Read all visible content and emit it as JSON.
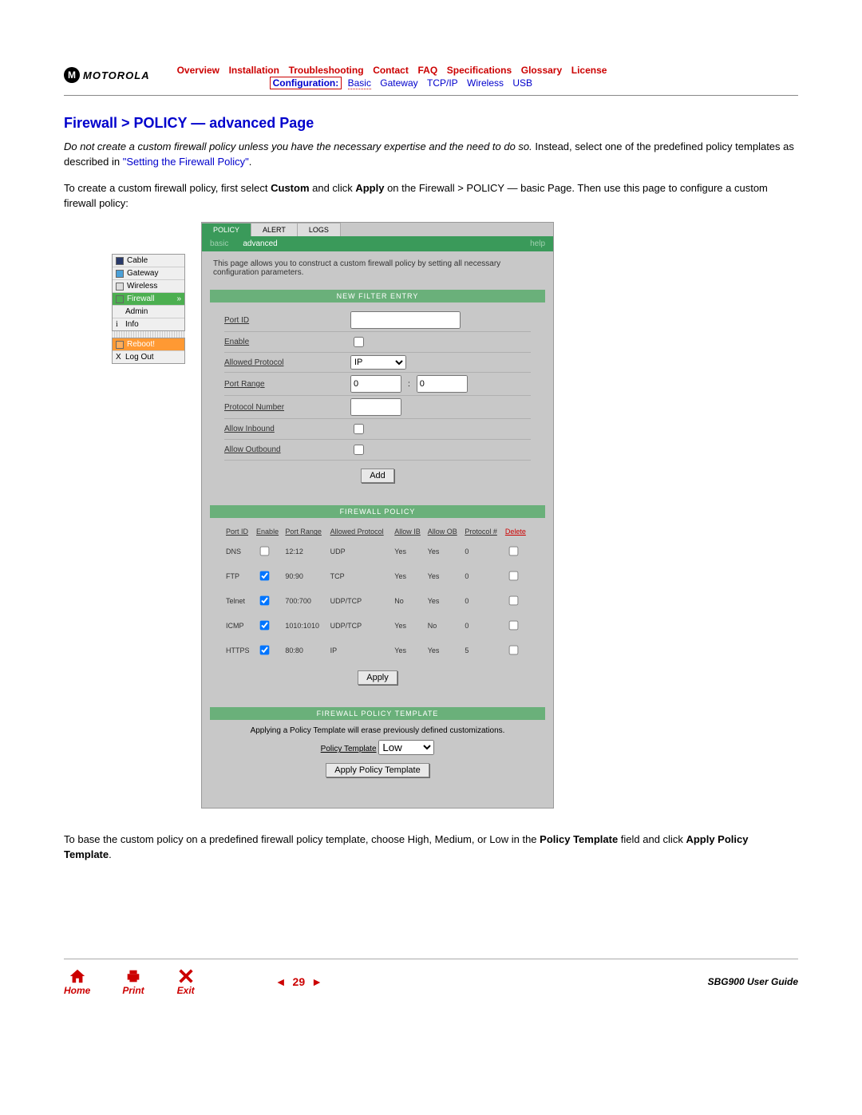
{
  "brand": "MOTOROLA",
  "topnav1": [
    "Overview",
    "Installation",
    "Troubleshooting",
    "Contact",
    "FAQ",
    "Specifications",
    "Glossary",
    "License"
  ],
  "topnav2": {
    "cfg": "Configuration:",
    "basic": "Basic",
    "links": [
      "Gateway",
      "TCP/IP",
      "Wireless",
      "USB"
    ]
  },
  "title": "Firewall > POLICY — advanced Page",
  "p1a": "Do not create a custom firewall policy unless you have the necessary expertise and the need to do so.",
  "p1b": " Instead, select one of the predefined policy templates as described in ",
  "p1link": "\"Setting the Firewall Policy\"",
  "p1c": ".",
  "p2a": "To create a custom firewall policy, first select ",
  "p2b": "Custom",
  "p2c": " and click ",
  "p2d": "Apply",
  "p2e": " on the Firewall > POLICY — basic Page. Then use this page to configure a custom firewall policy:",
  "sidebar": {
    "group1": [
      "Cable",
      "Gateway",
      "Wireless",
      "Firewall",
      "Admin",
      "Info"
    ],
    "reboot": "Reboot!",
    "logout": "Log Out"
  },
  "panel": {
    "tabs": [
      "POLICY",
      "ALERT",
      "LOGS"
    ],
    "subtabs": {
      "basic": "basic",
      "advanced": "advanced",
      "help": "help"
    },
    "desc": "This page allows you to construct a custom firewall policy by setting all necessary configuration parameters.",
    "bar1": "NEW FILTER ENTRY",
    "form": {
      "port_id": "Port ID",
      "enable": "Enable",
      "allowed_protocol": "Allowed Protocol",
      "protocol_value": "IP",
      "port_range": "Port Range",
      "pr1": "0",
      "pr2": "0",
      "sep": ":",
      "protocol_number": "Protocol Number",
      "allow_inbound": "Allow Inbound",
      "allow_outbound": "Allow Outbound",
      "add": "Add"
    },
    "bar2": "FIREWALL POLICY",
    "headers": [
      "Port ID",
      "Enable",
      "Port Range",
      "Allowed Protocol",
      "Allow IB",
      "Allow OB",
      "Protocol #",
      "Delete"
    ],
    "rows": [
      {
        "id": "DNS",
        "en": false,
        "pr": "12:12",
        "ap": "UDP",
        "ib": "Yes",
        "ob": "Yes",
        "pn": "0"
      },
      {
        "id": "FTP",
        "en": true,
        "pr": "90:90",
        "ap": "TCP",
        "ib": "Yes",
        "ob": "Yes",
        "pn": "0"
      },
      {
        "id": "Telnet",
        "en": true,
        "pr": "700:700",
        "ap": "UDP/TCP",
        "ib": "No",
        "ob": "Yes",
        "pn": "0"
      },
      {
        "id": "ICMP",
        "en": true,
        "pr": "1010:1010",
        "ap": "UDP/TCP",
        "ib": "Yes",
        "ob": "No",
        "pn": "0"
      },
      {
        "id": "HTTPS",
        "en": true,
        "pr": "80:80",
        "ap": "IP",
        "ib": "Yes",
        "ob": "Yes",
        "pn": "5"
      }
    ],
    "apply": "Apply",
    "bar3": "FIREWALL POLICY TEMPLATE",
    "template_note": "Applying a Policy Template will erase previously defined customizations.",
    "template_label": "Policy Template",
    "template_value": "Low",
    "apply_template": "Apply Policy Template"
  },
  "p3a": "To base the custom policy on a predefined firewall policy template, choose High, Medium, or Low in the ",
  "p3b": "Policy Template",
  "p3c": " field and click ",
  "p3d": "Apply Policy Template",
  "p3e": ".",
  "footer": {
    "home": "Home",
    "print": "Print",
    "exit": "Exit",
    "page": "29",
    "guide": "SBG900 User Guide"
  }
}
